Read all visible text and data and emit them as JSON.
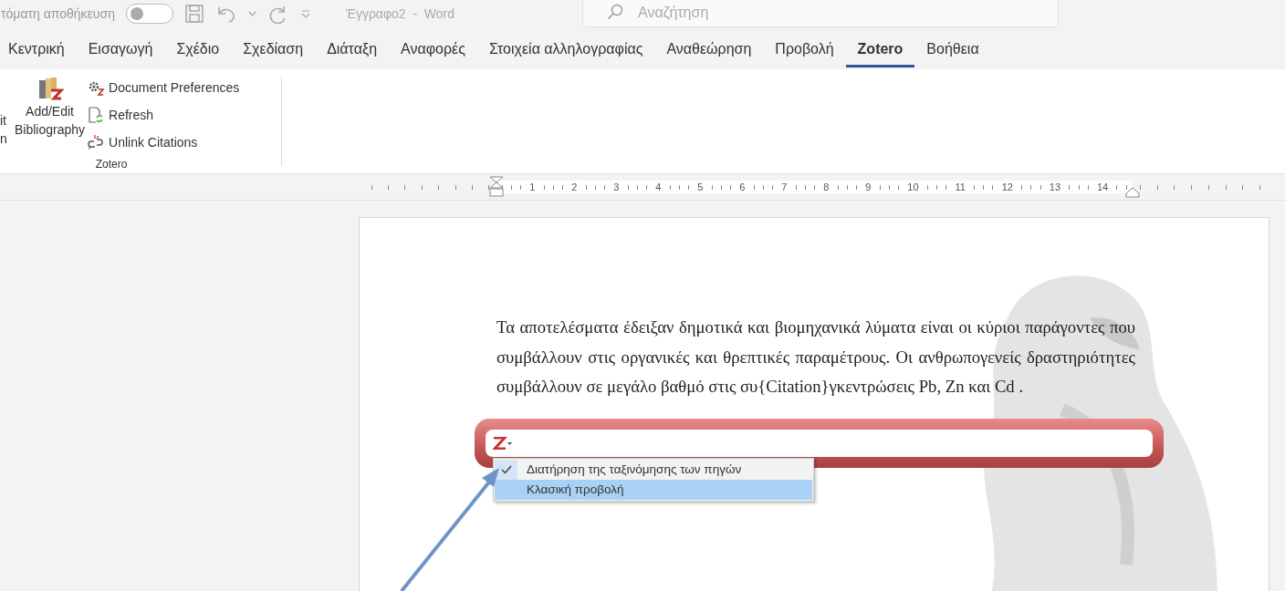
{
  "title_bar": {
    "autosave_label": "τόματη αποθήκευση",
    "autosave_on": false,
    "document_title": "Έγγραφο2  -  Word",
    "search": {
      "placeholder": "Αναζήτηση"
    }
  },
  "tabs": [
    {
      "label": "Κεντρική",
      "selected": false
    },
    {
      "label": "Εισαγωγή",
      "selected": false
    },
    {
      "label": "Σχέδιο",
      "selected": false
    },
    {
      "label": "Σχεδίαση",
      "selected": false
    },
    {
      "label": "Διάταξη",
      "selected": false
    },
    {
      "label": "Αναφορές",
      "selected": false
    },
    {
      "label": "Στοιχεία αλληλογραφίας",
      "selected": false
    },
    {
      "label": "Αναθεώρηση",
      "selected": false
    },
    {
      "label": "Προβολή",
      "selected": false
    },
    {
      "label": "Zotero",
      "selected": true
    },
    {
      "label": "Βοήθεια",
      "selected": false
    }
  ],
  "ribbon": {
    "cut_button": {
      "line_1": "it",
      "line_2": "n"
    },
    "large_button": {
      "line_1": "Add/Edit",
      "line_2": "Bibliography"
    },
    "small_buttons": [
      {
        "kind": "preferences",
        "label": "Document Preferences"
      },
      {
        "kind": "refresh",
        "label": "Refresh"
      },
      {
        "kind": "unlink",
        "label": "Unlink Citations"
      }
    ],
    "group_label": "Zotero"
  },
  "ruler": {
    "numbers": [
      "1",
      "2",
      "3",
      "4",
      "5",
      "6",
      "7",
      "8",
      "9",
      "10",
      "11",
      "12",
      "13",
      "14"
    ]
  },
  "document": {
    "paragraph": "Τα αποτελέσματα έδειξαν δημοτικά και βιομηχανικά λύματα είναι οι κύριοι παράγοντες που συμβάλλουν στις οργανικές και θρεπτικές παραμέτρους. Οι ανθρωπογενείς δραστηριότητες συμβάλλουν σε μεγάλο βαθμό στις συ{Citation}γκεντρώσεις Pb, Zn και Cd ."
  },
  "citation_menu": [
    {
      "label": "Διατήρηση της ταξινόμησης των πηγών",
      "checked": true,
      "selected": false
    },
    {
      "label": "Κλασική προβολή",
      "checked": false,
      "selected": true
    }
  ]
}
